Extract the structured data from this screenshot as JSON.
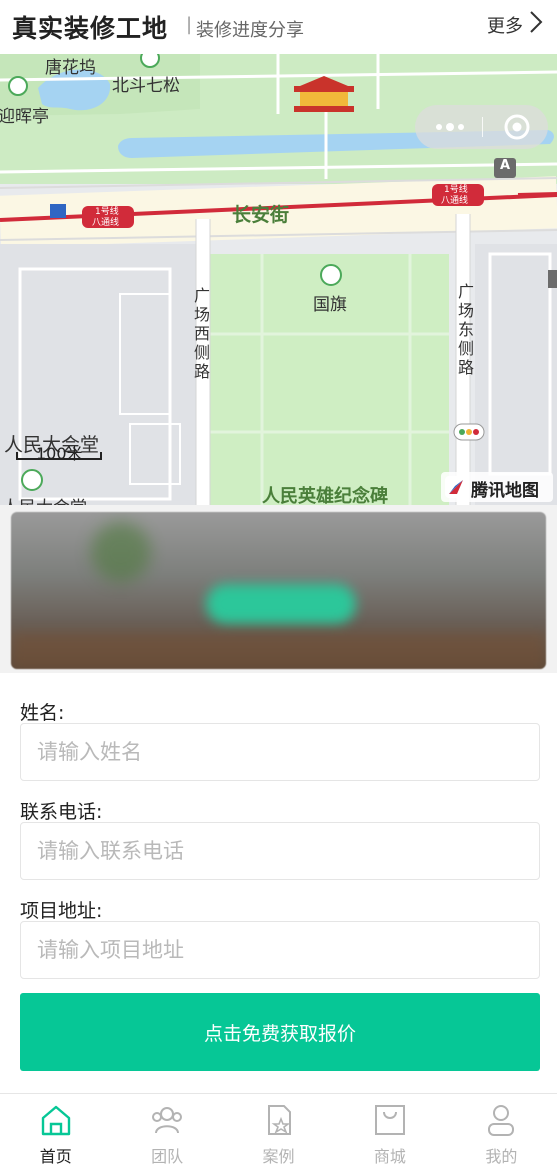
{
  "header": {
    "title": "真实装修工地",
    "separator": "|",
    "subtitle": "装修进度分享",
    "more_label": "更多"
  },
  "map": {
    "labels": {
      "tanghuawu": "唐花坞",
      "beidouqisong": "北斗七松",
      "yinghuiting": "迎晖亭",
      "changanjie": "长安街",
      "guoqi": "国旗",
      "guangchang_xi": "广场西侧路",
      "guangchang_dong": "广场东侧路",
      "renmin_dahuitang": "人民大会堂",
      "renmin_dahuitang_2": "人民大会堂",
      "monument": "人民英雄纪念碑",
      "line1_a": "1号线",
      "line1_b": "八通线",
      "line1_c": "1号线",
      "line1_d": "八通线",
      "exit_a": "A"
    },
    "scale_label": "100米",
    "brand_label": "腾讯地图",
    "colors": {
      "park": "#cdebc3",
      "water": "#a5d3f2",
      "road": "#fbf7e4",
      "metro": "#d12b3a",
      "block": "#dcdfe3"
    }
  },
  "banner": {
    "alt": ""
  },
  "form": {
    "name": {
      "label": "姓名:",
      "placeholder": "请输入姓名",
      "value": ""
    },
    "phone": {
      "label": "联系电话:",
      "placeholder": "请输入联系电话",
      "value": ""
    },
    "address": {
      "label": "项目地址:",
      "placeholder": "请输入项目地址",
      "value": ""
    },
    "submit_label": "点击免费获取报价",
    "accent": "#06c796"
  },
  "tabbar": {
    "items": [
      {
        "label": "首页",
        "icon": "home-icon",
        "active": true
      },
      {
        "label": "团队",
        "icon": "team-icon",
        "active": false
      },
      {
        "label": "案例",
        "icon": "case-icon",
        "active": false
      },
      {
        "label": "商城",
        "icon": "shop-icon",
        "active": false
      },
      {
        "label": "我的",
        "icon": "user-icon",
        "active": false
      }
    ],
    "active_color": "#06c796",
    "inactive_color": "#b3b3b3"
  }
}
